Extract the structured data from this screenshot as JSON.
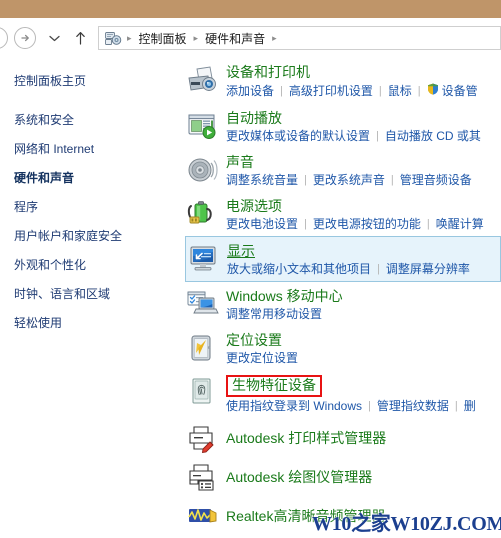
{
  "window": {
    "top_strip_color": "#bf9569",
    "accent_green": "#1a7a1a",
    "link_blue": "#1f57a8",
    "selected_bg": "#e6f3fb",
    "selected_border": "#99c7e0",
    "annotation_red": "#e81313"
  },
  "nav": {
    "back_icon": "back-arrow-icon",
    "forward_icon": "forward-arrow-icon",
    "recent_icon": "chevron-down-icon",
    "up_icon": "up-arrow-icon"
  },
  "breadcrumb": {
    "address_icon": "control-panel-icon",
    "sep": "▸",
    "items": [
      {
        "label": "控制面板"
      },
      {
        "label": "硬件和声音"
      }
    ],
    "trailing_sep": "▸"
  },
  "sidebar": {
    "home": "控制面板主页",
    "items": [
      {
        "label": "系统和安全",
        "current": false
      },
      {
        "label": "网络和 Internet",
        "current": false
      },
      {
        "label": "硬件和声音",
        "current": true
      },
      {
        "label": "程序",
        "current": false
      },
      {
        "label": "用户帐户和家庭安全",
        "current": false
      },
      {
        "label": "外观和个性化",
        "current": false
      },
      {
        "label": "时钟、语言和区域",
        "current": false
      },
      {
        "label": "轻松使用",
        "current": false
      }
    ]
  },
  "categories": [
    {
      "icon": "devices-and-printers-icon",
      "title": "设备和打印机",
      "selected": false,
      "boxed": false,
      "links": [
        {
          "label": "添加设备",
          "shield": false
        },
        {
          "label": "高级打印机设置",
          "shield": false
        },
        {
          "label": "鼠标",
          "shield": false
        },
        {
          "label": "设备管",
          "shield": true
        }
      ]
    },
    {
      "icon": "autoplay-icon",
      "title": "自动播放",
      "selected": false,
      "boxed": false,
      "links": [
        {
          "label": "更改媒体或设备的默认设置",
          "shield": false
        },
        {
          "label": "自动播放 CD 或其",
          "shield": false
        }
      ]
    },
    {
      "icon": "sound-icon",
      "title": "声音",
      "selected": false,
      "boxed": false,
      "links": [
        {
          "label": "调整系统音量",
          "shield": false
        },
        {
          "label": "更改系统声音",
          "shield": false
        },
        {
          "label": "管理音频设备",
          "shield": false
        }
      ]
    },
    {
      "icon": "power-options-icon",
      "title": "电源选项",
      "selected": false,
      "boxed": false,
      "links": [
        {
          "label": "更改电池设置",
          "shield": false
        },
        {
          "label": "更改电源按钮的功能",
          "shield": false
        },
        {
          "label": "唤醒计算",
          "shield": false
        }
      ]
    },
    {
      "icon": "display-icon",
      "title": "显示",
      "selected": true,
      "boxed": false,
      "links": [
        {
          "label": "放大或缩小文本和其他项目",
          "shield": false
        },
        {
          "label": "调整屏幕分辨率",
          "shield": false
        }
      ]
    },
    {
      "icon": "windows-mobility-center-icon",
      "title": "Windows 移动中心",
      "selected": false,
      "boxed": false,
      "links": [
        {
          "label": "调整常用移动设置",
          "shield": false
        }
      ]
    },
    {
      "icon": "location-settings-icon",
      "title": "定位设置",
      "selected": false,
      "boxed": false,
      "links": [
        {
          "label": "更改定位设置",
          "shield": false
        }
      ]
    },
    {
      "icon": "biometric-devices-icon",
      "title": "生物特征设备",
      "selected": false,
      "boxed": true,
      "links": [
        {
          "label": "使用指纹登录到 Windows",
          "shield": false
        },
        {
          "label": "管理指纹数据",
          "shield": false
        },
        {
          "label": "删",
          "shield": false
        }
      ]
    },
    {
      "icon": "autodesk-plot-style-manager-icon",
      "title": "Autodesk 打印样式管理器",
      "selected": false,
      "boxed": false,
      "links": []
    },
    {
      "icon": "autodesk-plotter-manager-icon",
      "title": "Autodesk 绘图仪管理器",
      "selected": false,
      "boxed": false,
      "links": []
    },
    {
      "icon": "realtek-hd-audio-manager-icon",
      "title": "Realtek高清晰音频管理器",
      "selected": false,
      "boxed": false,
      "links": []
    }
  ],
  "watermark": {
    "text_cn": "W10之家",
    "text_en": "W10ZJ.COM"
  }
}
